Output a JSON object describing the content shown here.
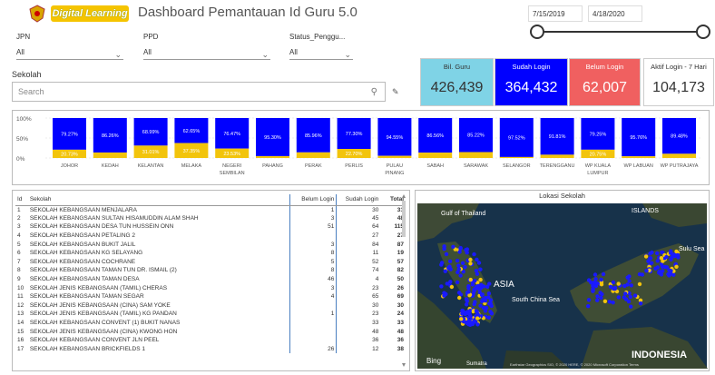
{
  "header": {
    "logo_text": "Digital Learning",
    "title": "Dashboard Pemantauan Id Guru 5.0",
    "date_start": "7/15/2019",
    "date_end": "4/18/2020"
  },
  "filters": [
    {
      "label": "JPN",
      "value": "All"
    },
    {
      "label": "PPD",
      "value": "All"
    },
    {
      "label": "Status_Penggu...",
      "value": "All"
    }
  ],
  "search": {
    "label": "Sekolah",
    "placeholder": "Search"
  },
  "cards": [
    {
      "label": "Bil. Guru",
      "value": "426,439",
      "color": "#7fd3e6"
    },
    {
      "label": "Sudah Login",
      "value": "364,432",
      "color": "#0000ff"
    },
    {
      "label": "Belum Login",
      "value": "62,007",
      "color": "#f06060"
    },
    {
      "label": "Aktif Login - 7 Hari",
      "value": "104,173",
      "color": "#ffffff"
    }
  ],
  "chart_data": {
    "type": "bar",
    "stacked": true,
    "y_ticks": [
      "100%",
      "50%",
      "0%"
    ],
    "ylim": [
      0,
      100
    ],
    "categories": [
      "JOHOR",
      "KEDAH",
      "KELANTAN",
      "MELAKA",
      "NEGERI SEMBILAN",
      "PAHANG",
      "PERAK",
      "PERLIS",
      "PULAU PINANG",
      "SABAH",
      "SARAWAK",
      "SELANGOR",
      "TERENGGANU",
      "WP KUALA LUMPUR",
      "WP LABUAN",
      "WP PUTRAJAYA"
    ],
    "series": [
      {
        "values": [
          79.27,
          86.26,
          68.99,
          62.65,
          76.47,
          95.3,
          85.96,
          77.3,
          94.55,
          86.56,
          85.22,
          97.52,
          91.81,
          79.25,
          95.76,
          89.48
        ],
        "color": "#0000ff"
      },
      {
        "values": [
          20.73,
          13.74,
          31.01,
          37.35,
          23.53,
          4.7,
          14.04,
          22.7,
          5.45,
          13.44,
          14.78,
          2.48,
          8.19,
          20.75,
          4.24,
          10.52
        ],
        "color": "#f2c40c"
      }
    ],
    "labels_top": [
      "79.27%",
      "86.26%",
      "68.99%",
      "62.65%",
      "76.47%",
      "95.30%",
      "85.96%",
      "77.30%",
      "94.55%",
      "86.56%",
      "85.22%",
      "97.52%",
      "91.81%",
      "79.25%",
      "95.76%",
      "89.48%"
    ],
    "labels_bottom": [
      "20.73%",
      "",
      "31.01%",
      "37.35%",
      "23.53%",
      "",
      "",
      "22.70%",
      "",
      "",
      "",
      "",
      "",
      "20.75%",
      "",
      ""
    ]
  },
  "table": {
    "headers": [
      "Id",
      "Sekolah",
      "Belum Login",
      "Sudah Login",
      "Total"
    ],
    "rows": [
      [
        "1",
        "SEKOLAH KEBANGSAAN MENJALARA",
        "1",
        "30",
        "31"
      ],
      [
        "2",
        "SEKOLAH KEBANGSAAN SULTAN HISAMUDDIN ALAM SHAH",
        "3",
        "45",
        "48"
      ],
      [
        "3",
        "SEKOLAH KEBANGSAAN DESA TUN HUSSEIN ONN",
        "51",
        "64",
        "115"
      ],
      [
        "4",
        "SEKOLAH KEBANGSAAN PETALING 2",
        "",
        "27",
        "27"
      ],
      [
        "5",
        "SEKOLAH KEBANGSAAN BUKIT JALIL",
        "3",
        "84",
        "87"
      ],
      [
        "6",
        "SEKOLAH KEBANGSAAN KG SELAYANG",
        "8",
        "11",
        "19"
      ],
      [
        "7",
        "SEKOLAH KEBANGSAAN COCHRANE",
        "5",
        "52",
        "57"
      ],
      [
        "8",
        "SEKOLAH KEBANGSAAN TAMAN TUN DR. ISMAIL (2)",
        "8",
        "74",
        "82"
      ],
      [
        "9",
        "SEKOLAH KEBANGSAAN TAMAN DESA",
        "46",
        "4",
        "50"
      ],
      [
        "10",
        "SEKOLAH JENIS KEBANGSAAN (TAMIL) CHERAS",
        "3",
        "23",
        "26"
      ],
      [
        "11",
        "SEKOLAH KEBANGSAAN TAMAN SEGAR",
        "4",
        "65",
        "69"
      ],
      [
        "12",
        "SEKOLAH JENIS KEBANGSAAN (CINA) SAM YOKE",
        "",
        "30",
        "30"
      ],
      [
        "13",
        "SEKOLAH JENIS KEBANGSAAN (TAMIL) KG PANDAN",
        "1",
        "23",
        "24"
      ],
      [
        "14",
        "SEKOLAH KEBANGSAAN CONVENT (1) BUKIT NANAS",
        "",
        "33",
        "33"
      ],
      [
        "15",
        "SEKOLAH JENIS KEBANGSAAN (CINA) KWONG HON",
        "",
        "48",
        "48"
      ],
      [
        "16",
        "SEKOLAH KEBANGSAAN CONVENT JLN PEEL",
        "",
        "36",
        "36"
      ],
      [
        "17",
        "SEKOLAH KEBANGSAAN BRICKFIELDS 1",
        "26",
        "12",
        "38"
      ]
    ]
  },
  "map": {
    "title": "Lokasi Sekolah",
    "labels": [
      "Gulf of Thailand",
      "ISLANDS",
      "Sulu Sea",
      "South China Sea",
      "ASIA",
      "INDONESIA",
      "Sumatra"
    ],
    "brand": "Bing",
    "copyright": "Earthstar Geographics SIO, © 2020 HERE, © 2020 Microsoft Corporation Terms"
  }
}
